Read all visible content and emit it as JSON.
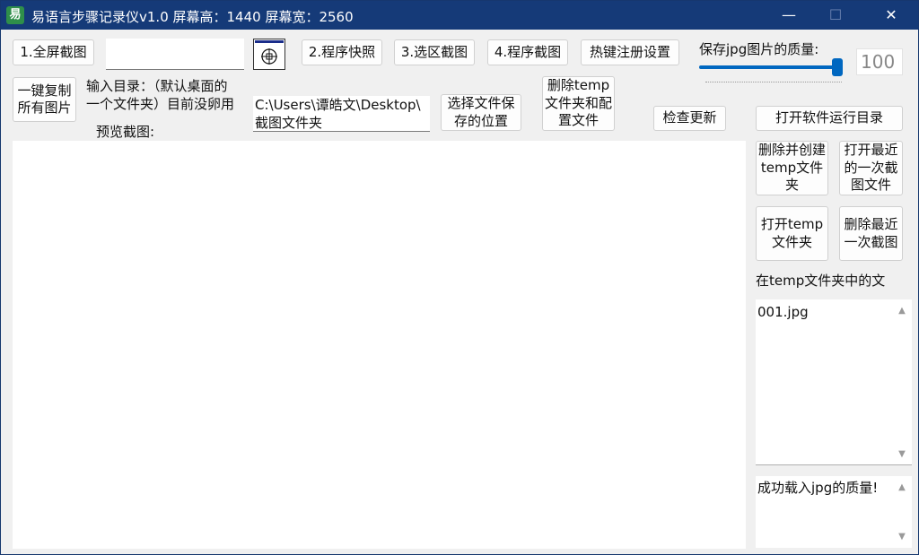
{
  "window": {
    "title": "易语言步骤记录仪v1.0 屏幕高：1440 屏幕宽：2560",
    "minimize_glyph": "—",
    "maximize_glyph": "☐",
    "close_glyph": "✕",
    "app_icon": "app-logo-icon"
  },
  "toolbar": {
    "fullscreen_capture": "1.全屏截图",
    "program_snapshot": "2.程序快照",
    "region_capture": "3.选区截图",
    "program_capture": "4.程序截图",
    "hotkey_settings": "热键注册设置",
    "crosshair_icon": "target-crosshair-icon"
  },
  "quality": {
    "label": "保存jpg图片的质量:",
    "value": "100",
    "slider_fraction": 1.0
  },
  "left": {
    "copy_all_line1": "一键复制",
    "copy_all_line2": "所有图片",
    "input_dir_line1": "输入目录：（默认桌面的",
    "input_dir_line2": "一个文件夹）目前没卵用",
    "preview_label": "预览截图:"
  },
  "path": {
    "value_line1": "C:\\Users\\谭皓文\\Desktop\\",
    "value_line2": "截图文件夹"
  },
  "buttons": {
    "choose_save_line1": "选择文件保",
    "choose_save_line2": "存的位置",
    "delete_temp_line1": "删除temp",
    "delete_temp_line2": "文件夹和配",
    "delete_temp_line3": "置文件",
    "check_update": "检查更新",
    "open_run_dir": "打开软件运行目录",
    "delete_create_temp_line1": "删除并创建",
    "delete_create_temp_line2": "temp文件",
    "delete_create_temp_line3": "夹",
    "open_recent_line1": "打开最近",
    "open_recent_line2": "的一次截",
    "open_recent_line3": "图文件",
    "open_temp_line1": "打开temp",
    "open_temp_line2": "文件夹",
    "delete_recent_line1": "删除最近",
    "delete_recent_line2": "一次截图"
  },
  "temp_list": {
    "label": "在temp文件夹中的文",
    "items": [
      "001.jpg"
    ]
  },
  "log": {
    "text": "成功载入jpg的质量!"
  }
}
